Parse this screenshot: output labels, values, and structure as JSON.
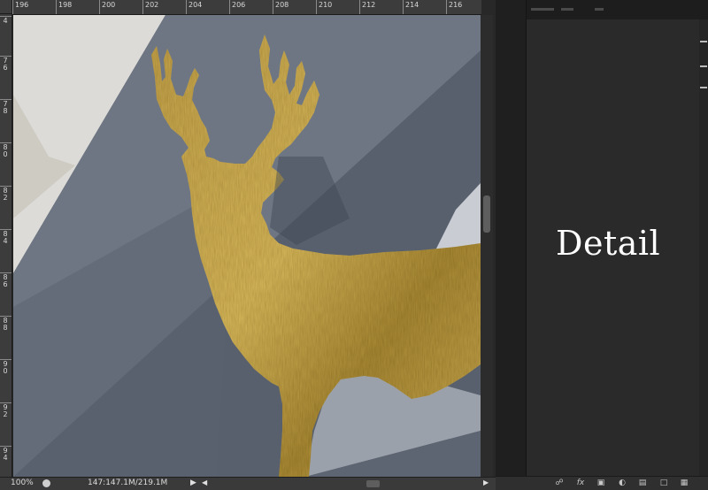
{
  "ruler": {
    "top_labels": [
      "196",
      "198",
      "200",
      "202",
      "204",
      "206",
      "208",
      "210",
      "212",
      "214",
      "216"
    ],
    "left_labels": [
      "4",
      "76",
      "78",
      "80",
      "82",
      "84",
      "86",
      "88",
      "90",
      "92",
      "94"
    ]
  },
  "statusbar": {
    "zoom": "100%",
    "doc_size": "147:147.1M/219.1M"
  },
  "panel": {
    "detail_text": "Detail",
    "layer_icons": [
      "link-icon",
      "fx-icon",
      "mask-icon",
      "adjustment-icon",
      "folder-icon",
      "new-layer-icon",
      "trash-icon"
    ]
  },
  "colors": {
    "background": "#4f5764",
    "deer": "#b89a3e",
    "panel": "#2a2a2a",
    "ruler": "#3c3c3c"
  }
}
